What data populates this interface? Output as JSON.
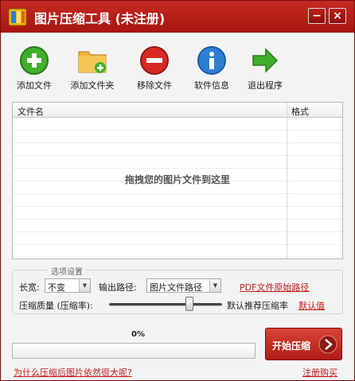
{
  "window": {
    "title": "图片压缩工具 (未注册)",
    "min_glyph": "−",
    "close_glyph": "×"
  },
  "toolbar": {
    "items": [
      {
        "label": "添加文件",
        "icon": "plus-circle-icon"
      },
      {
        "label": "添加文件夹",
        "icon": "folder-add-icon"
      },
      {
        "label": "移除文件",
        "icon": "minus-circle-icon"
      },
      {
        "label": "软件信息",
        "icon": "info-icon"
      },
      {
        "label": "退出程序",
        "icon": "exit-arrow-icon"
      }
    ]
  },
  "file_list": {
    "columns": [
      "文件名",
      "格式"
    ],
    "rows": [],
    "drop_hint": "拖拽您的图片文件到这里"
  },
  "options": {
    "title": "选项设置",
    "size_label": "长宽:",
    "size_value": "不变",
    "output_label": "输出路径:",
    "output_value": "图片文件路径",
    "pdf_link": "PDF文件原始路径",
    "quality_label": "压缩质量 (压缩率):",
    "quality_level": 0.71,
    "recommend_text": "默认推荐压缩率",
    "default_link": "默认值"
  },
  "progress": {
    "text": "0%",
    "value": 0
  },
  "actions": {
    "start_label": "开始压缩",
    "faq_link": "为什么压缩后图片依然很大呢?",
    "register_link": "注册购买"
  },
  "colors": {
    "accent": "#b01c14",
    "link": "#c21c1c"
  }
}
